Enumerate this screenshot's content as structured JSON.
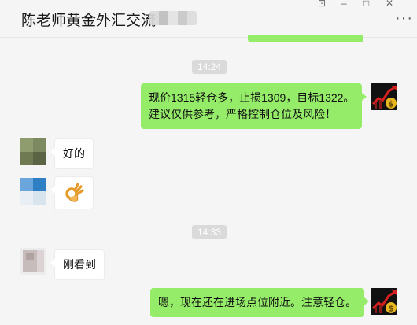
{
  "header": {
    "title": "陈老师黄金外汇交流",
    "window_controls": [
      "⊡",
      "–",
      "□",
      "✕"
    ],
    "more_label": "···"
  },
  "timestamps": [
    "14:24",
    "14:33"
  ],
  "messages": [
    {
      "side": "right",
      "lines": [
        "现价1315轻仓多，止损1309，目标1322。",
        "建议仅供参考，严格控制仓位及风险！"
      ]
    },
    {
      "side": "left",
      "text": "好的"
    },
    {
      "side": "left",
      "emoji": "👌"
    },
    {
      "side": "left",
      "text": "刚看到"
    },
    {
      "side": "right",
      "text": "嗯，现在还在进场点位附近。注意轻仓。"
    }
  ],
  "colors": {
    "bubble_self": "#95ec69",
    "bubble_other": "#ffffff",
    "background": "#f5f5f5"
  }
}
